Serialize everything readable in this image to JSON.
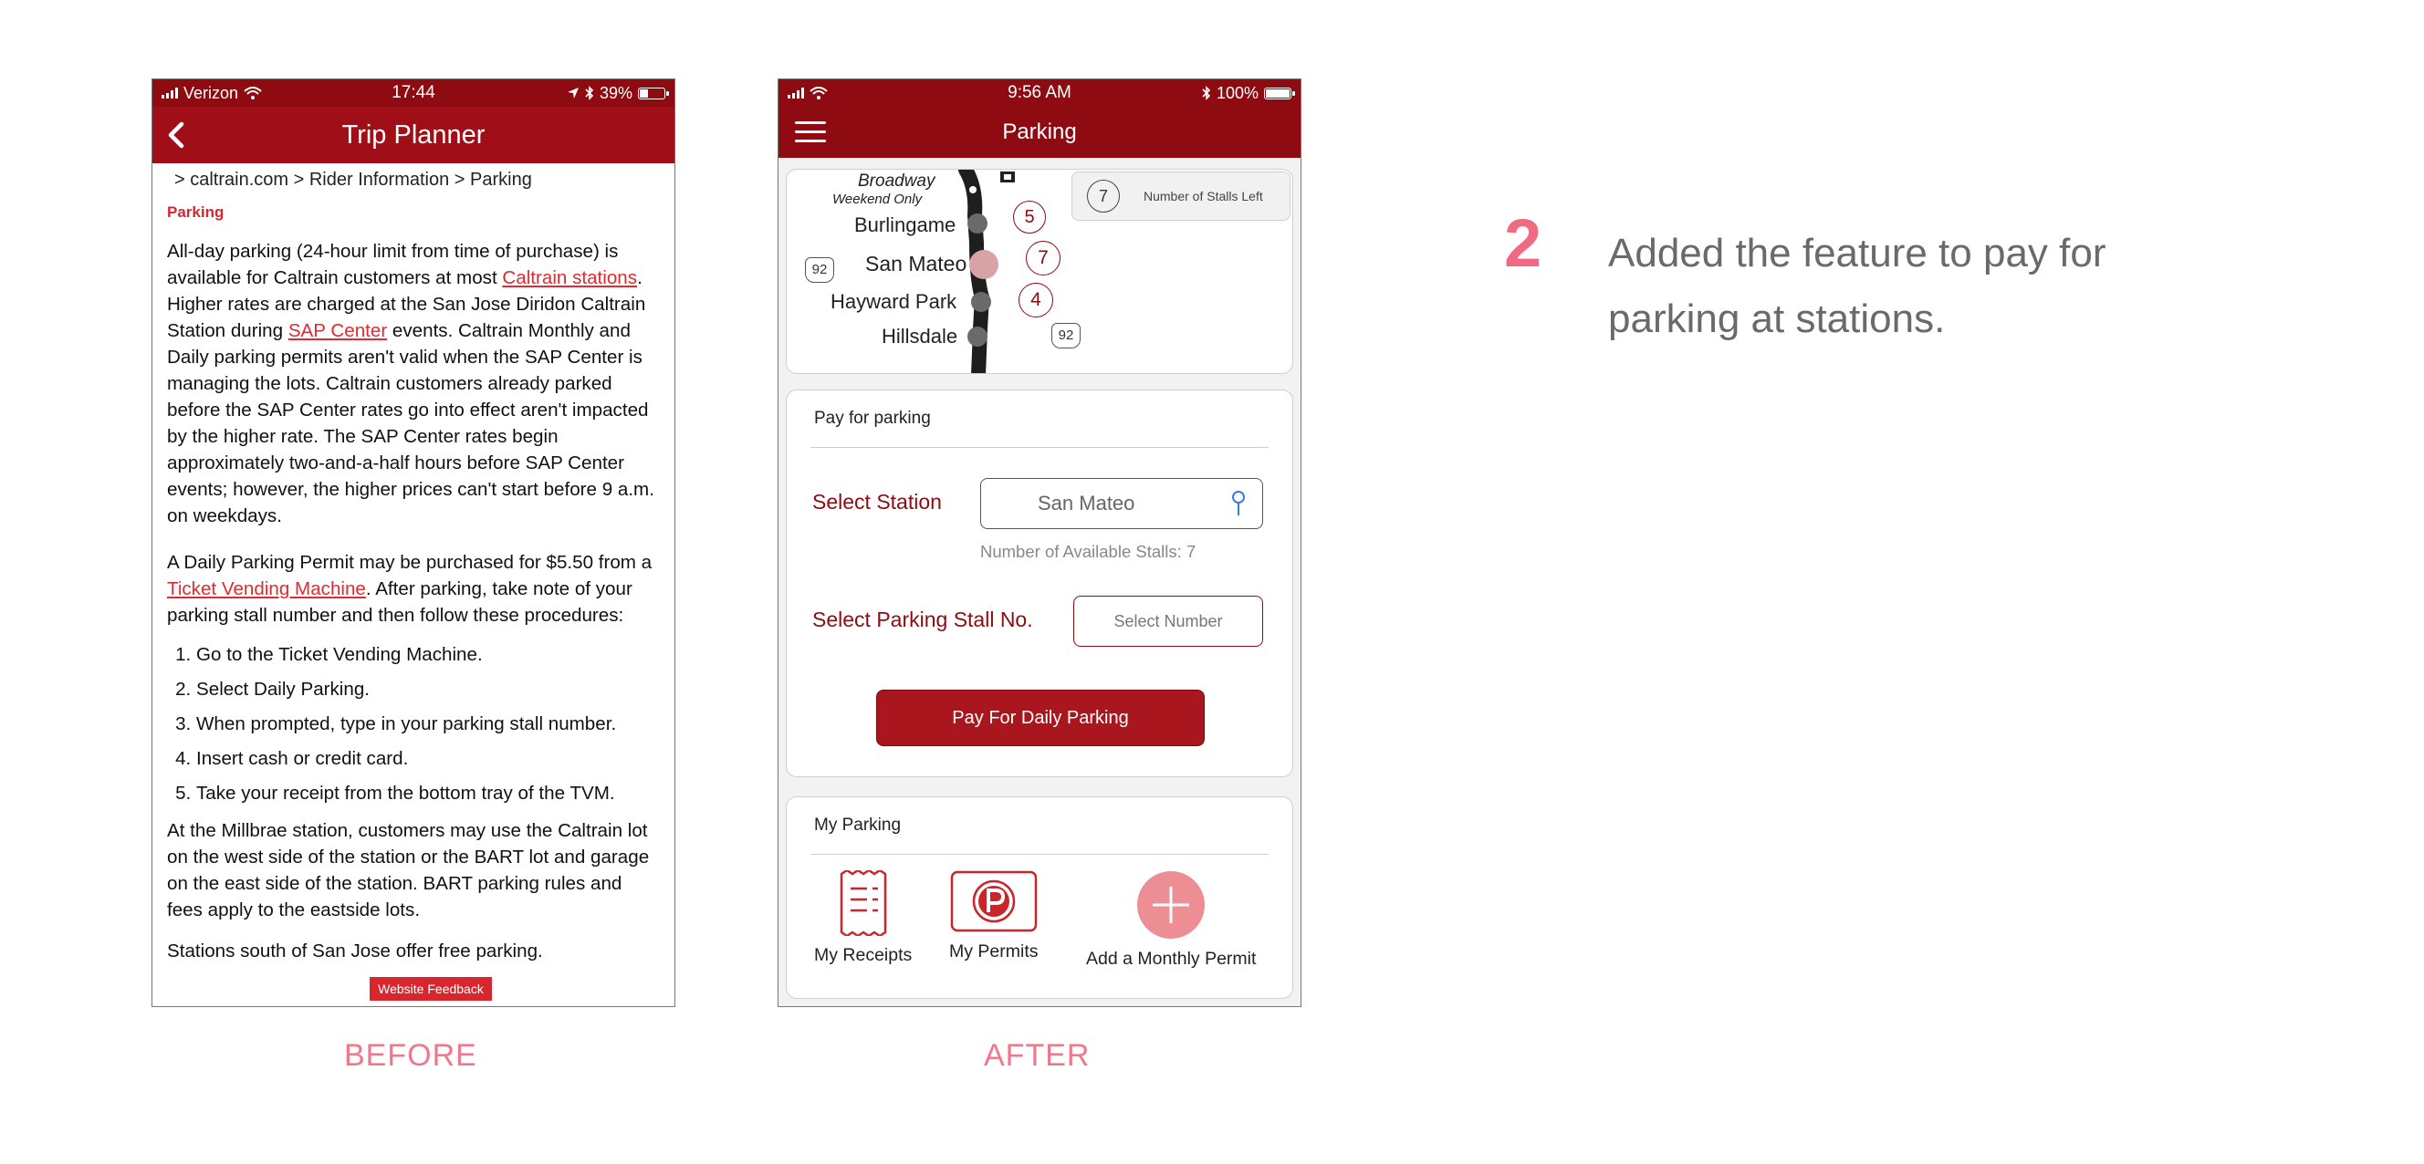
{
  "before": {
    "status": {
      "carrier": "Verizon",
      "time": "17:44",
      "battery": "39%",
      "battery_level": 0.39
    },
    "nav_title": "Trip Planner",
    "breadcrumb": "> caltrain.com > Rider Information > Parking",
    "section_title": "Parking",
    "p1": {
      "t1": "All-day parking (24-hour limit from time of purchase) is available for Caltrain customers at most ",
      "link1": "Caltrain stations",
      "t2": ". Higher rates are charged at the San Jose Diridon Caltrain Station during ",
      "link2": "SAP Center",
      "t3": " events. Caltrain Monthly and Daily parking permits aren't valid when the SAP Center is managing the lots. Caltrain customers already parked before the SAP Center rates go into effect aren't impacted by the higher rate. The SAP Center rates begin approximately two-and-a-half hours before SAP Center events; however, the higher prices can't start before 9 a.m. on weekdays."
    },
    "p2": {
      "t1": "A Daily Parking Permit may be purchased for $5.50 from a ",
      "link": "Ticket Vending Machine",
      "t2": ". After parking, take note of your parking stall number and then follow these procedures:"
    },
    "steps": [
      "Go to the Ticket Vending Machine.",
      "Select Daily Parking.",
      "When prompted, type in your parking stall number.",
      "Insert cash or credit card.",
      "Take your receipt from the bottom tray of the TVM."
    ],
    "p3": "At the Millbrae station, customers may use the Caltrain lot on the west side of the station or the BART lot and garage on the east side of the station. BART parking rules and fees apply to the eastside lots.",
    "p4": "Stations south of San Jose offer free parking.",
    "feedback": "Website Feedback"
  },
  "after": {
    "status": {
      "time": "9:56 AM",
      "battery": "100%",
      "battery_level": 1.0
    },
    "nav_title": "Parking",
    "map": {
      "stations": [
        "Broadway",
        "Burlingame",
        "San Mateo",
        "Hayward Park",
        "Hillsdale"
      ],
      "broadway_note": "Weekend Only",
      "stall_counts": [
        "5",
        "7",
        "4"
      ],
      "highway": "92",
      "legend_value": "7",
      "legend_label": "Number of Stalls Left"
    },
    "pay": {
      "title": "Pay for parking",
      "station_label": "Select Station",
      "station_value": "San Mateo",
      "available": "Number of Available Stalls: 7",
      "stall_label": "Select Parking Stall No.",
      "stall_placeholder": "Select Number",
      "button": "Pay For Daily Parking"
    },
    "my_parking": {
      "title": "My Parking",
      "items": [
        "My Receipts",
        "My Permits",
        "Add a Monthly Permit"
      ]
    }
  },
  "labels": {
    "before": "BEFORE",
    "after": "AFTER"
  },
  "note": {
    "number": "2",
    "text": "Added the feature to pay for parking at stations."
  },
  "colors": {
    "brand_red": "#8e0b12",
    "link_red": "#e12a31",
    "caption_pink": "#f0788b",
    "add_pink": "#ec8e93"
  }
}
